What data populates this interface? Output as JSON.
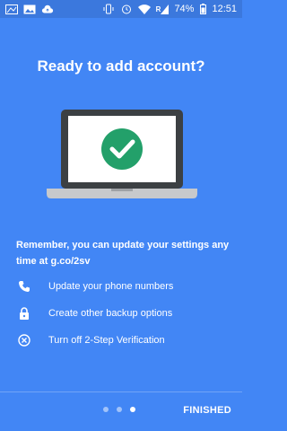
{
  "status_bar": {
    "battery": "74%",
    "time": "12:51",
    "left_icons": [
      "image-icon",
      "photo-icon",
      "cloud-upload-icon"
    ],
    "right_icons": [
      "vibrate-icon",
      "alarm-icon",
      "wifi-icon",
      "signal-icon",
      "battery-icon"
    ],
    "signal_label": "R"
  },
  "header": {
    "title": "Ready to add account?"
  },
  "illustration": {
    "icon": "laptop-check-icon",
    "check_color": "#23a06a"
  },
  "info": {
    "text": "Remember, you can update your settings any time at g.co/2sv"
  },
  "options": [
    {
      "icon": "phone-icon",
      "label": "Update your phone numbers"
    },
    {
      "icon": "lock-icon",
      "label": "Create other backup options"
    },
    {
      "icon": "cancel-icon",
      "label": "Turn off 2-Step Verification"
    }
  ],
  "footer": {
    "finished_label": "FINISHED",
    "page_count": 3,
    "current_page": 3
  },
  "colors": {
    "background": "#4286f5",
    "status_bar": "#3b78dd"
  }
}
